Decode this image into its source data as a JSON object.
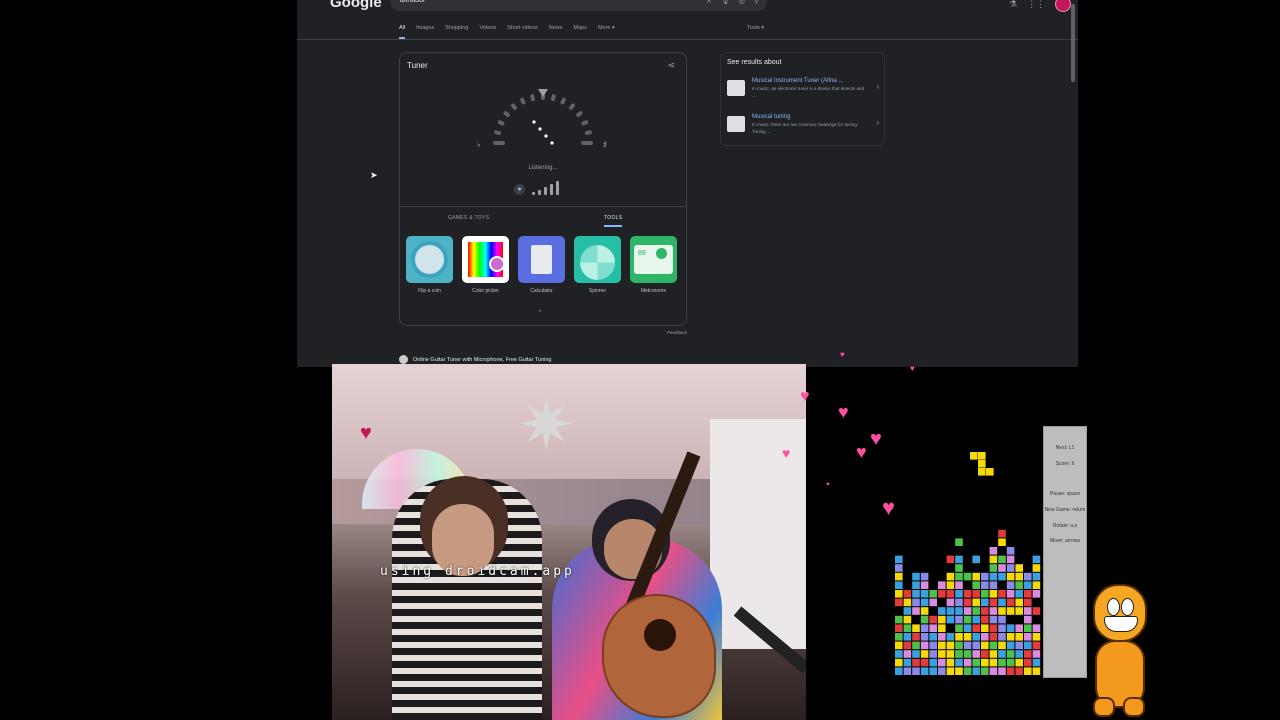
{
  "browser": {
    "logo": "Google",
    "search_query": "afinador",
    "search_icons": [
      "clear-icon",
      "mic-icon",
      "lens-icon",
      "search-icon"
    ],
    "nav_tabs": [
      "All",
      "Images",
      "Shopping",
      "Videos",
      "Short videos",
      "News",
      "Maps",
      "More ▾"
    ],
    "tools_label": "Tools ▾",
    "top_icons": [
      "labs-icon",
      "apps-grid-icon",
      "avatar"
    ],
    "tuner": {
      "title": "Tuner",
      "flat": "♭",
      "sharp": "♯",
      "status": "Listening...",
      "categories": [
        "GAMES & TOYS",
        "TOOLS"
      ],
      "active_category": "TOOLS",
      "apps": [
        {
          "name": "Flip a coin",
          "color": "#4fb3c8"
        },
        {
          "name": "Color picker",
          "color": "#ffffff"
        },
        {
          "name": "Calculator",
          "color": "#5b6ee1"
        },
        {
          "name": "Spinner",
          "color": "#26bfa5"
        },
        {
          "name": "Metronome",
          "color": "#2fb567"
        }
      ],
      "metronome_readout": "88",
      "feedback": "Feedback"
    },
    "see_results": {
      "heading": "See results about",
      "items": [
        {
          "title": "Musical Instrument Tuner (Afina ...",
          "desc": "In music, an electronic tuner is a device that detects and ..."
        },
        {
          "title": "Musical tuning",
          "desc": "In music, there are two common meanings for tuning. Tuning ..."
        }
      ]
    },
    "next_result": "Online Guitar Tuner with Microphone, Free Guitar Tuning"
  },
  "webcam": {
    "overlay_text": "using droidcam.app"
  },
  "tetris": {
    "next": "Next: L1",
    "score": "Score: 9",
    "pause": "Pause: space",
    "new_game": "New Game: return",
    "rotate": "Rotate: a,s",
    "move": "Move: arrows",
    "colors": [
      "#f5d90a",
      "#e33b3b",
      "#3aa0e0",
      "#4cc24a",
      "#d98be0",
      "#8a8ae8"
    ]
  }
}
